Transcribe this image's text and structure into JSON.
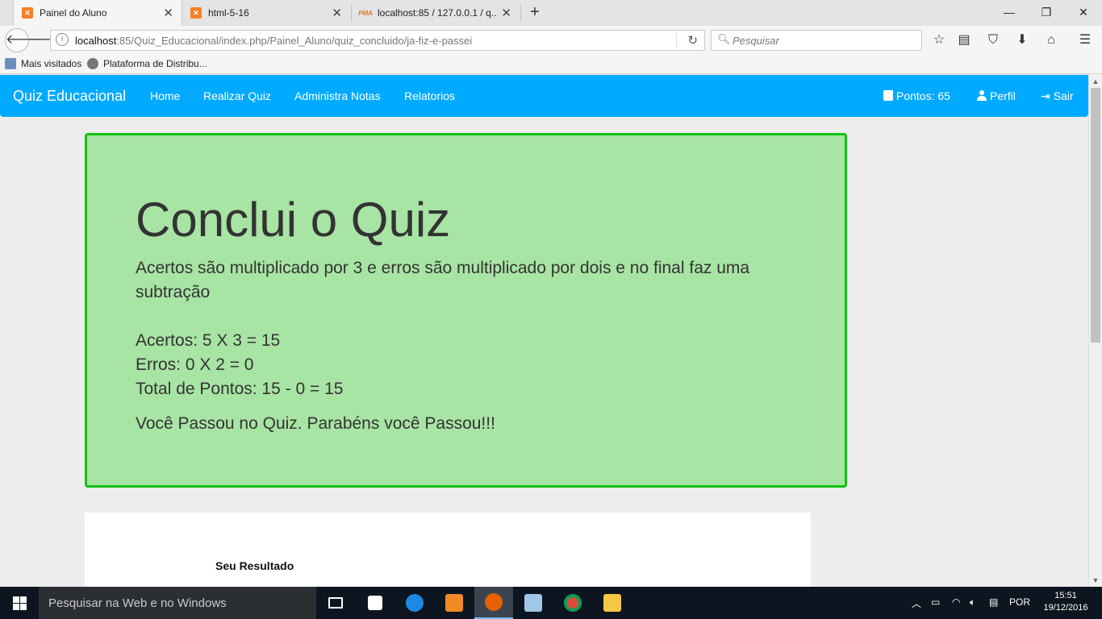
{
  "browser": {
    "tabs": [
      {
        "title": "Painel do Aluno",
        "icon": "xampp-icon",
        "active": true
      },
      {
        "title": "html-5-16",
        "icon": "xampp-icon",
        "active": false
      },
      {
        "title": "localhost:85 / 127.0.0.1 / q...",
        "icon": "phpmyadmin-icon",
        "active": false
      }
    ],
    "new_tab": "+",
    "window_controls": {
      "minimize": "—",
      "restore": "❐",
      "close": "✕"
    },
    "url": {
      "host": "localhost",
      "rest": ":85/Quiz_Educacional/index.php/Painel_Aluno/quiz_concluido/ja-fiz-e-passei"
    },
    "search_placeholder": "Pesquisar",
    "bookmarks": [
      {
        "label": "Mais visitados"
      },
      {
        "label": "Plataforma de Distribu..."
      }
    ]
  },
  "app": {
    "brand": "Quiz Educacional",
    "nav": [
      {
        "label": "Home"
      },
      {
        "label": "Realizar Quiz"
      },
      {
        "label": "Administra Notas"
      },
      {
        "label": "Relatorios"
      }
    ],
    "right_nav": {
      "points": "Pontos: 65",
      "profile": "Perfil",
      "logout": "Sair"
    },
    "colors": {
      "navbar": "#00aaff",
      "jumbotron_bg": "#a8e4a4",
      "jumbotron_border": "#11c011"
    }
  },
  "result": {
    "title": "Conclui o Quiz",
    "rule": "Acertos são multiplicado por 3 e erros são multiplicado por dois e no final faz uma subtração",
    "lines": [
      "Acertos: 5 X 3 = 15",
      "Erros: 0 X 2 = 0",
      "Total de Pontos: 15 - 0 = 15"
    ],
    "message": "Você Passou no Quiz. Parabéns você Passou!!!"
  },
  "result_card": {
    "title": "Seu Resultado"
  },
  "taskbar": {
    "search_placeholder": "Pesquisar na Web e no Windows",
    "apps": [
      "task-view-icon",
      "store-icon",
      "edge-icon",
      "media-player-icon",
      "firefox-icon",
      "box-icon",
      "chrome-icon",
      "file-explorer-icon"
    ],
    "language": "POR",
    "time": "15:51",
    "date": "19/12/2016"
  }
}
